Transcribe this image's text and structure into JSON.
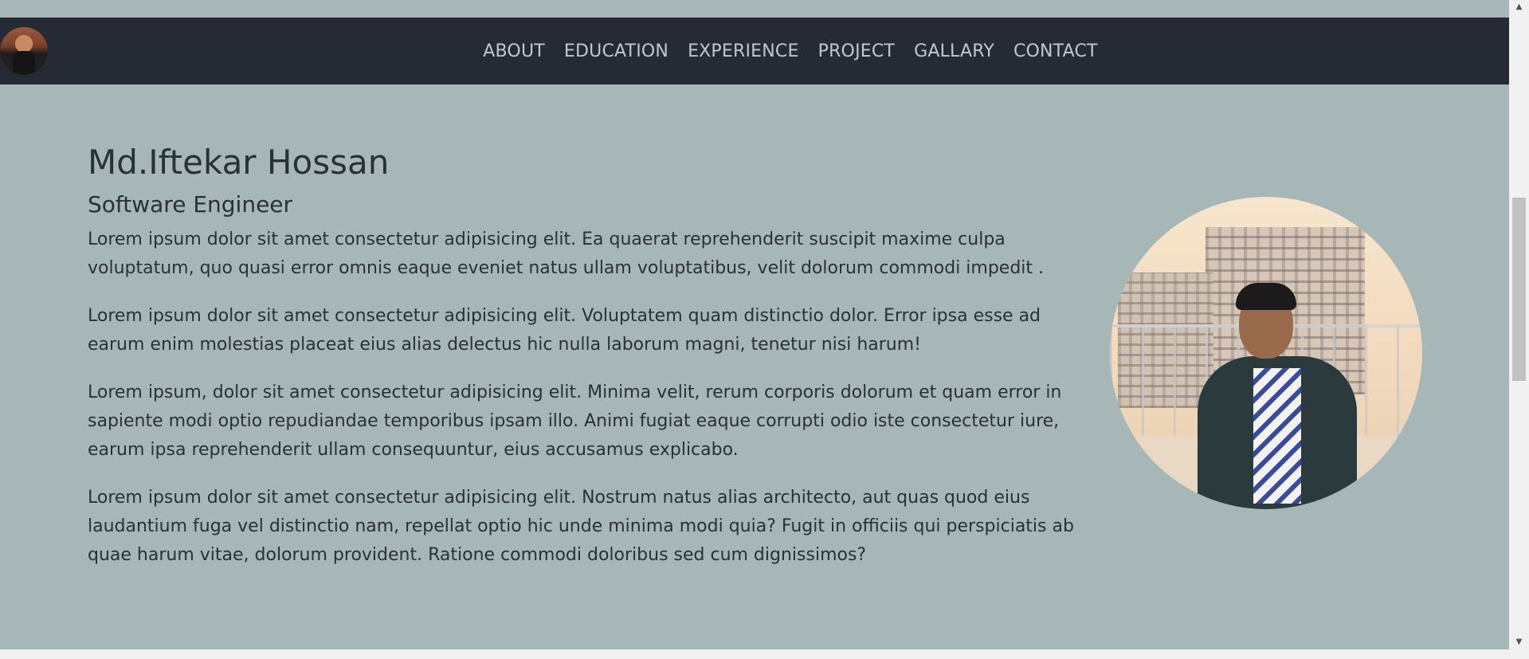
{
  "nav": {
    "links": [
      "ABOUT",
      "EDUCATION",
      "EXPERIENCE",
      "PROJECT",
      "GALLARY",
      "CONTACT"
    ]
  },
  "about": {
    "name": "Md.Iftekar Hossan",
    "role": "Software Engineer",
    "paragraphs": [
      "Lorem ipsum dolor sit amet consectetur adipisicing elit. Ea quaerat reprehenderit suscipit maxime culpa voluptatum, quo quasi error omnis eaque eveniet natus ullam voluptatibus, velit dolorum commodi impedit .",
      "Lorem ipsum dolor sit amet consectetur adipisicing elit. Voluptatem quam distinctio dolor. Error ipsa esse ad earum enim molestias placeat eius alias delectus hic nulla laborum magni, tenetur nisi harum!",
      "Lorem ipsum, dolor sit amet consectetur adipisicing elit. Minima velit, rerum corporis dolorum et quam error in sapiente modi optio repudiandae temporibus ipsam illo. Animi fugiat eaque corrupti odio iste consectetur iure, earum ipsa reprehenderit ullam consequuntur, eius accusamus explicabo.",
      "Lorem ipsum dolor sit amet consectetur adipisicing elit. Nostrum natus alias architecto, aut quas quod eius laudantium fuga vel distinctio nam, repellat optio hic unde minima modi quia? Fugit in officiis qui perspiciatis ab quae harum vitae, dolorum provident. Ratione commodi doloribus sed cum dignissimos?"
    ]
  },
  "icons": {
    "scroll_up": "scroll-up-arrow-icon",
    "scroll_down": "scroll-down-arrow-icon"
  },
  "colors": {
    "page_background": "#a7b7b8",
    "navbar": "#262a35",
    "nav_text": "#c3c7cc",
    "body_text": "#2a3038"
  }
}
